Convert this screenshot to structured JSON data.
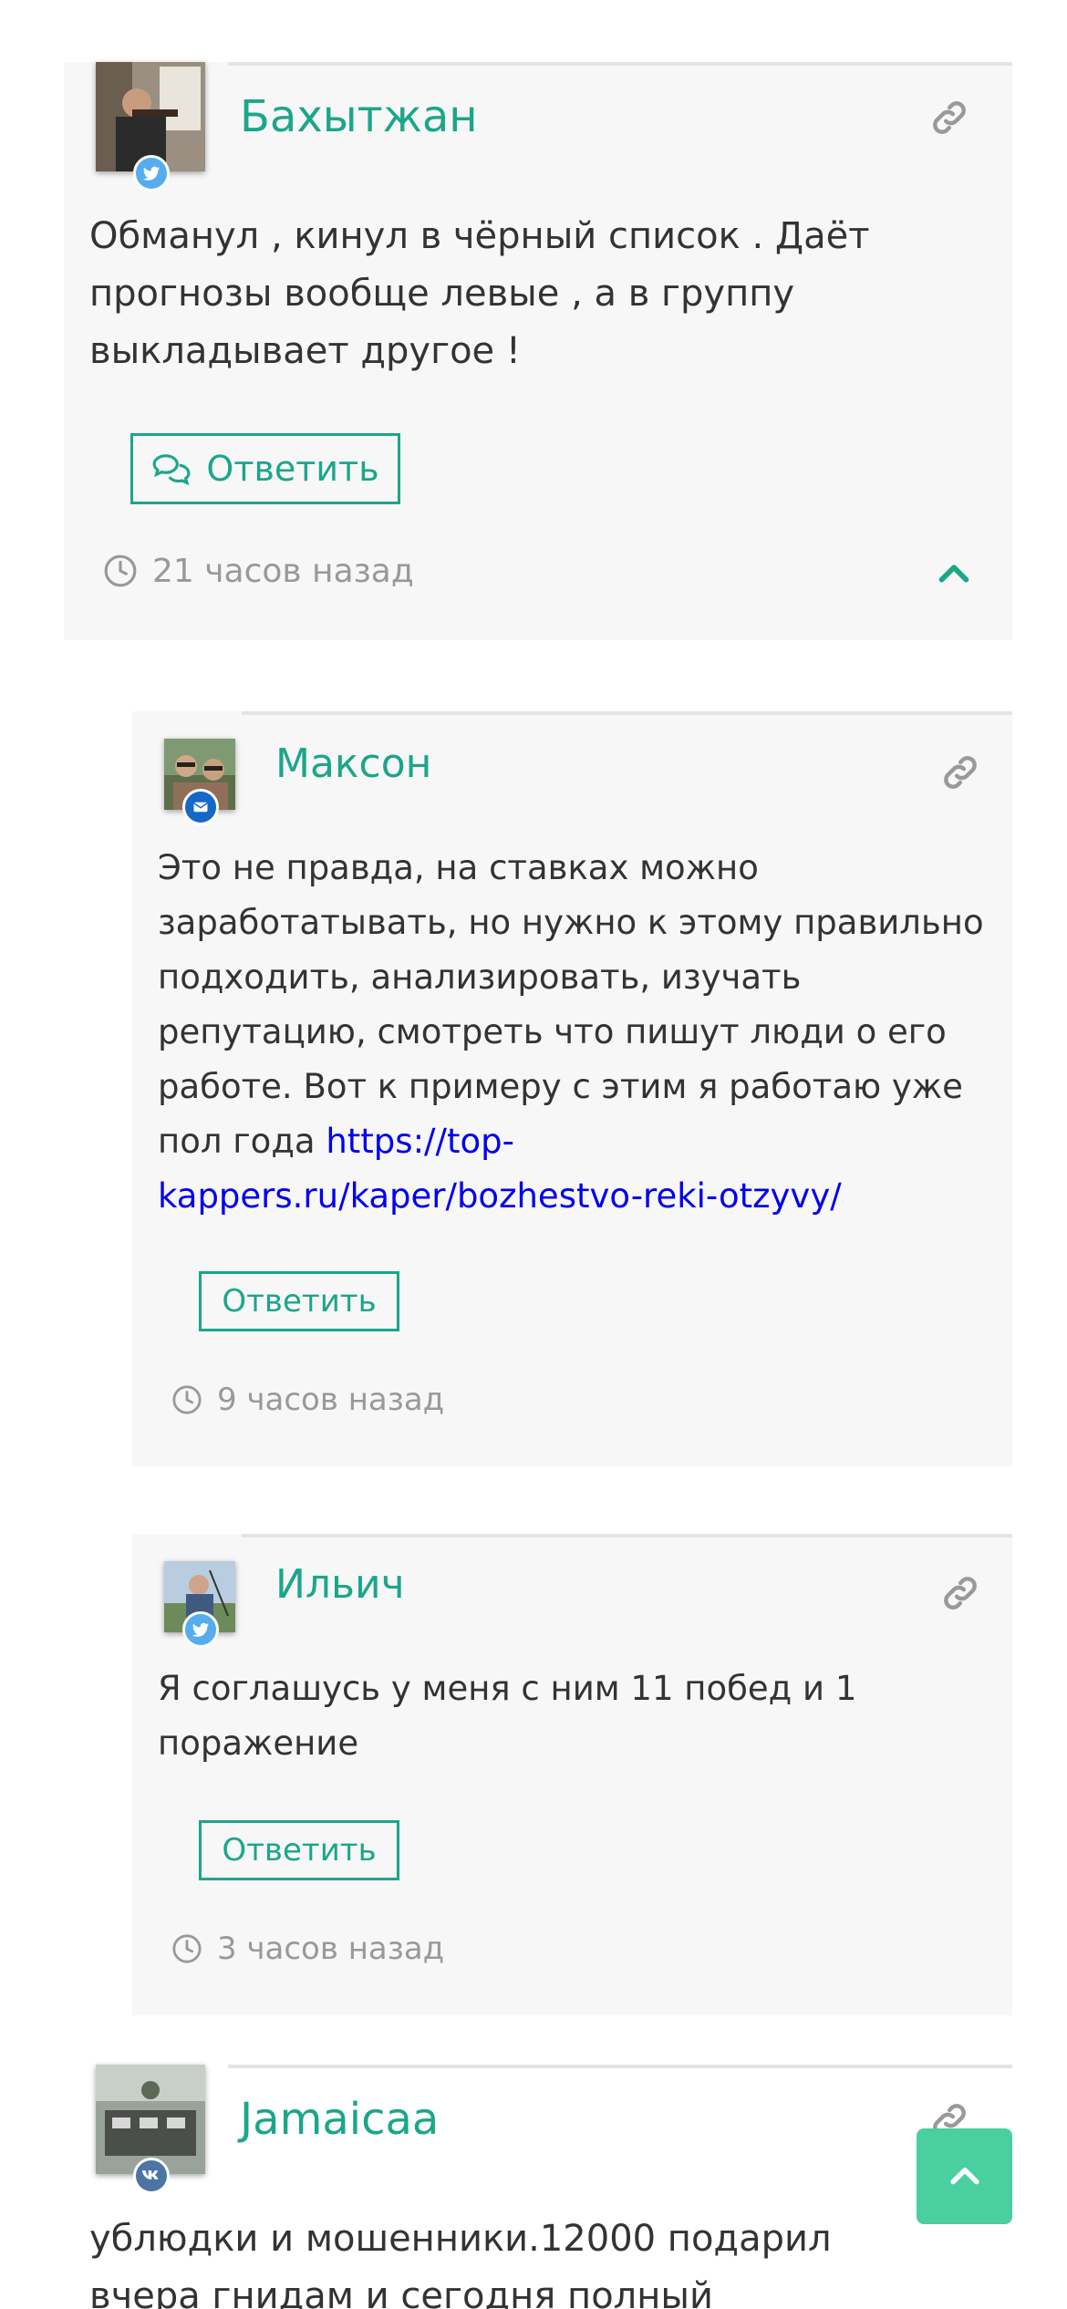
{
  "colors": {
    "accent": "#1ba68a",
    "card_bg": "#f7f7f7",
    "text": "#333333",
    "muted": "#999999",
    "link": "#0000ee",
    "scroll_top_bg": "#49cfa0"
  },
  "comments": [
    {
      "author": "Бахытжан",
      "avatar_badge": "twitter-icon",
      "text": "Обманул , кинул в чёрный список . Даёт прогнозы вообще левые , а в группу выкладывает другое !",
      "reply_label": "Ответить",
      "time": "21 часов назад"
    },
    {
      "author": "Максон",
      "avatar_badge": "mail-icon",
      "text": "Это не правда, на ставках можно заработатывать, но нужно к этому правильно подходить, анализировать, изучать репутацию, смотреть что пишут люди о его работе. Вот к примеру с этим я работаю уже пол года ",
      "link_text": "https://top-kappers.ru/kaper/bozhestvo-reki-otzyvy/",
      "reply_label": "Ответить",
      "time": "9 часов назад"
    },
    {
      "author": "Ильич",
      "avatar_badge": "twitter-icon",
      "text": "Я соглашусь у меня с ним 11 побед и 1 поражение",
      "reply_label": "Ответить",
      "time": "3 часов назад"
    },
    {
      "author": "Jamaicaa",
      "avatar_badge": "vk-icon",
      "text": "ублюдки и мошенники.12000 подарил вчера гнидам и сегодня полный"
    }
  ],
  "icons": {
    "permalink": "link-icon",
    "clock": "clock-icon",
    "reply": "comments-icon",
    "collapse": "chevron-up-icon",
    "scroll_top": "arrow-up-icon"
  }
}
